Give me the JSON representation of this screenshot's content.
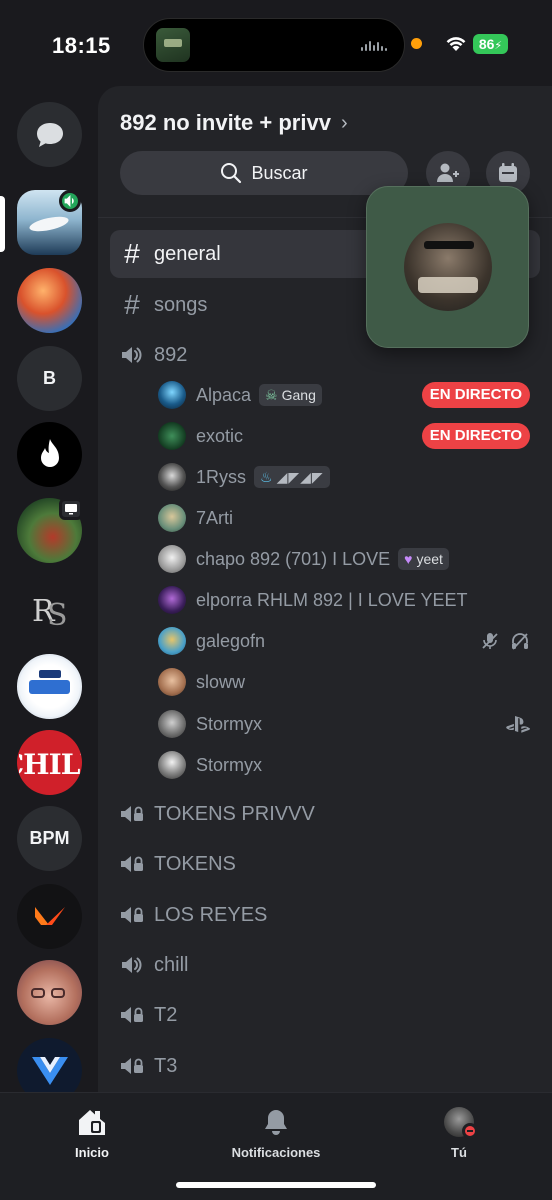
{
  "status_bar": {
    "time": "18:15",
    "battery": "86"
  },
  "server": {
    "name": "892 no invite + privv",
    "search_label": "Buscar"
  },
  "rail": {
    "text_servers": [
      "B",
      "BPM"
    ]
  },
  "channels": {
    "text": [
      {
        "name": "general",
        "selected": true
      },
      {
        "name": "songs",
        "selected": false
      }
    ],
    "voice_active": {
      "name": "892",
      "members": [
        {
          "name": "Alpaca",
          "tag": "Gang",
          "live": "EN DIRECTO"
        },
        {
          "name": "exotic",
          "live": "EN DIRECTO"
        },
        {
          "name": "1Ryss",
          "tag": "◢◤◢◤"
        },
        {
          "name": "7Arti"
        },
        {
          "name": "chapo 892 (701) I LOVE",
          "tag": "yeet"
        },
        {
          "name": "elporra RHLM 892 | I LOVE YEET"
        },
        {
          "name": "galegofn"
        },
        {
          "name": "sloww"
        },
        {
          "name": "Stormyx"
        },
        {
          "name": "Stormyx"
        }
      ]
    },
    "voice": [
      {
        "name": "TOKENS PRIVVV",
        "locked": true
      },
      {
        "name": "TOKENS",
        "locked": true
      },
      {
        "name": "LOS REYES",
        "locked": true
      },
      {
        "name": "chill",
        "locked": false
      },
      {
        "name": "T2",
        "locked": true
      },
      {
        "name": "T3",
        "locked": true
      }
    ]
  },
  "nav": {
    "home": "Inicio",
    "notifications": "Notificaciones",
    "you": "Tú"
  },
  "colors": {
    "live": "#ed4245",
    "battery": "#34c759",
    "panel": "#232428"
  }
}
